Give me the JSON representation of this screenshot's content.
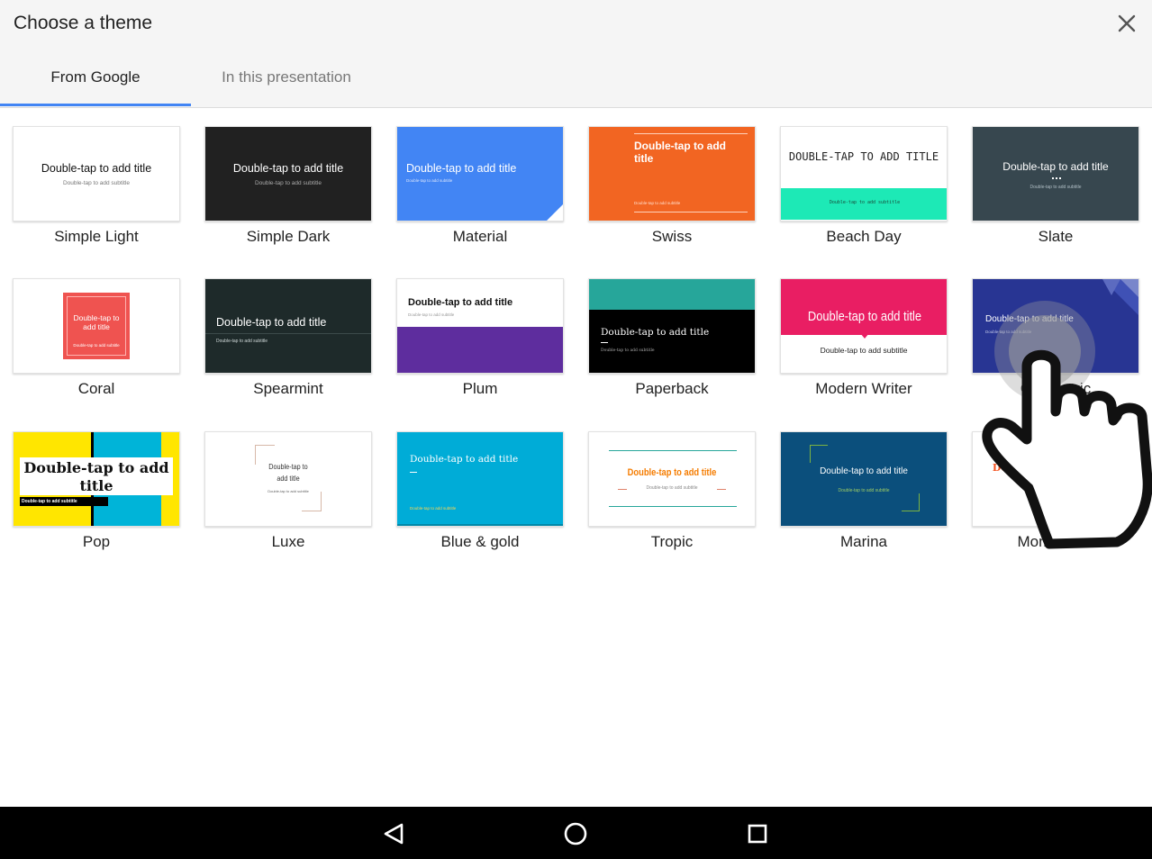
{
  "dialog": {
    "title": "Choose a theme",
    "tabs": [
      {
        "label": "From Google",
        "active": true
      },
      {
        "label": "In this presentation",
        "active": false
      }
    ],
    "accent": "#4285f4"
  },
  "preview_text": {
    "title": "Double-tap to add title",
    "subtitle": "Double-tap to add subtitle",
    "title_beach": "DOUBLE-TAP TO ADD TITLE",
    "title_swiss_l1": "Double-tap to add",
    "title_swiss_l2": "title",
    "title_coral_l1": "Double-tap to",
    "title_coral_l2": "add title",
    "title_pop_l1": "Double-tap to add",
    "title_pop_l2": "title",
    "title_luxe_l1": "Double-tap to",
    "title_luxe_l2": "add title"
  },
  "themes": [
    {
      "name": "Simple Light"
    },
    {
      "name": "Simple Dark"
    },
    {
      "name": "Material"
    },
    {
      "name": "Swiss"
    },
    {
      "name": "Beach Day"
    },
    {
      "name": "Slate"
    },
    {
      "name": "Coral"
    },
    {
      "name": "Spearmint"
    },
    {
      "name": "Plum"
    },
    {
      "name": "Paperback"
    },
    {
      "name": "Modern Writer"
    },
    {
      "name": "Geometric"
    },
    {
      "name": "Pop"
    },
    {
      "name": "Luxe"
    },
    {
      "name": "Blue & gold"
    },
    {
      "name": "Tropic"
    },
    {
      "name": "Marina"
    },
    {
      "name": "Momentum"
    }
  ],
  "icons": {
    "close": "close-icon",
    "back": "nav-back-icon",
    "home": "nav-home-icon",
    "recents": "nav-recents-icon",
    "hand": "tap-gesture-hand-icon"
  }
}
